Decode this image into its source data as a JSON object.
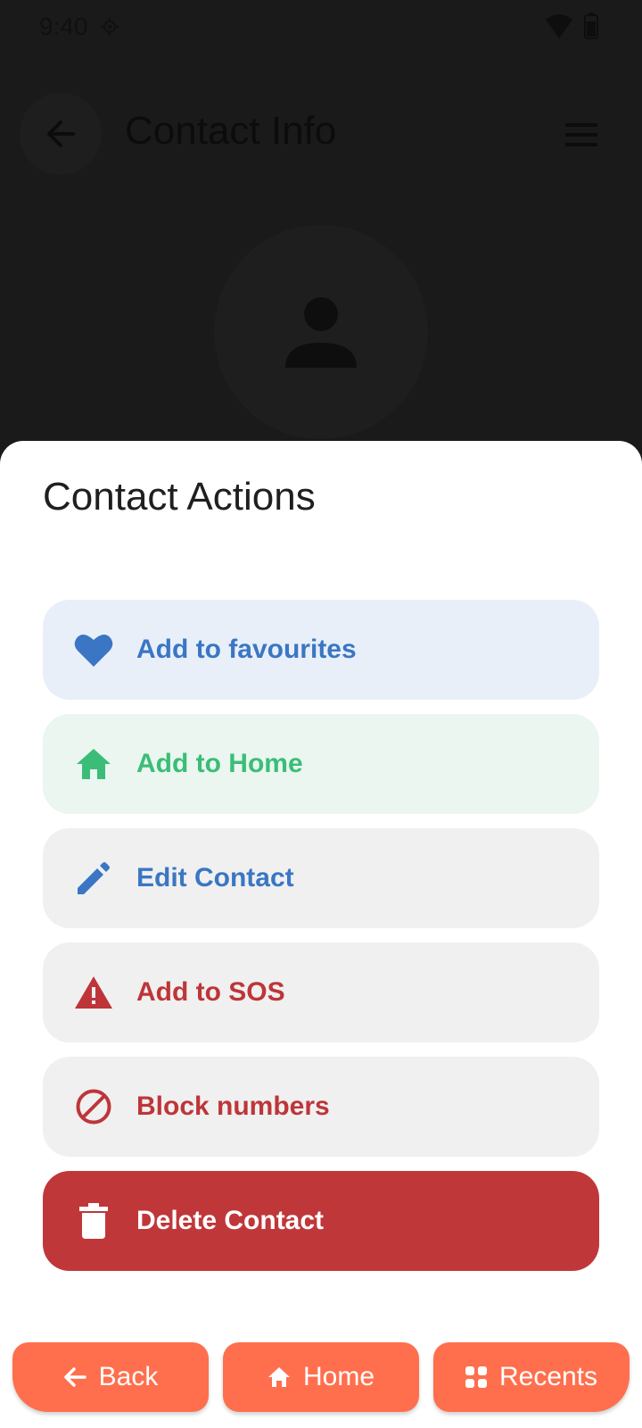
{
  "status_bar": {
    "time": "9:40",
    "icons": [
      "location-icon",
      "wifi-icon",
      "battery-icon"
    ]
  },
  "app_bar": {
    "title": "Contact Info",
    "back_icon": "arrow-left-icon",
    "menu_icon": "hamburger-menu-icon"
  },
  "avatar": {
    "icon": "person-icon"
  },
  "sheet": {
    "title": "Contact Actions",
    "actions": [
      {
        "label": "Add to favourites",
        "icon": "heart-icon",
        "color": "#3a76c4",
        "background": "#e9eff8"
      },
      {
        "label": "Add to Home",
        "icon": "home-icon",
        "color": "#3bbd78",
        "background": "#eaf6ef"
      },
      {
        "label": "Edit Contact",
        "icon": "pencil-icon",
        "color": "#3a76c4",
        "background": "#f0f0f0"
      },
      {
        "label": "Add to SOS",
        "icon": "warning-icon",
        "color": "#be3539",
        "background": "#f0f0f0"
      },
      {
        "label": "Block numbers",
        "icon": "block-icon",
        "color": "#be3539",
        "background": "#f0f0f0"
      },
      {
        "label": "Delete Contact",
        "icon": "trash-icon",
        "color": "#ffffff",
        "background": "#c0373a"
      }
    ]
  },
  "bottom_nav": {
    "accent": "#ff6f4d",
    "items": [
      {
        "label": "Back",
        "icon": "arrow-left-icon"
      },
      {
        "label": "Home",
        "icon": "home-icon"
      },
      {
        "label": "Recents",
        "icon": "grid-icon"
      }
    ]
  }
}
